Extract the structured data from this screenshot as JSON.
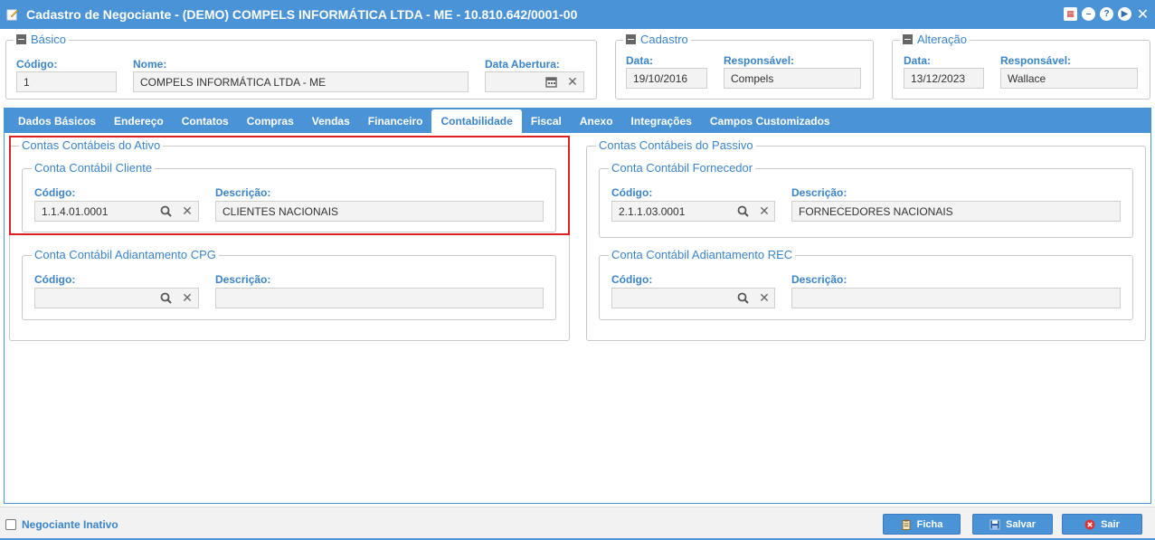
{
  "window": {
    "title": "Cadastro de Negociante - (DEMO) COMPELS INFORMÁTICA LTDA - ME - 10.810.642/0001-00"
  },
  "basico": {
    "legend": "Básico",
    "codigo_label": "Código:",
    "codigo_value": "1",
    "nome_label": "Nome:",
    "nome_value": "COMPELS INFORMÁTICA LTDA - ME",
    "data_abertura_label": "Data Abertura:",
    "data_abertura_value": ""
  },
  "cadastro": {
    "legend": "Cadastro",
    "data_label": "Data:",
    "data_value": "19/10/2016",
    "responsavel_label": "Responsável:",
    "responsavel_value": "Compels"
  },
  "alteracao": {
    "legend": "Alteração",
    "data_label": "Data:",
    "data_value": "13/12/2023",
    "responsavel_label": "Responsável:",
    "responsavel_value": "Wallace"
  },
  "tabs": [
    {
      "label": "Dados Básicos"
    },
    {
      "label": "Endereço"
    },
    {
      "label": "Contatos"
    },
    {
      "label": "Compras"
    },
    {
      "label": "Vendas"
    },
    {
      "label": "Financeiro"
    },
    {
      "label": "Contabilidade",
      "active": true
    },
    {
      "label": "Fiscal"
    },
    {
      "label": "Anexo"
    },
    {
      "label": "Integrações"
    },
    {
      "label": "Campos Customizados"
    }
  ],
  "ativo": {
    "legend": "Contas Contábeis do Ativo",
    "cliente": {
      "legend": "Conta Contábil Cliente",
      "codigo_label": "Código:",
      "codigo_value": "1.1.4.01.0001",
      "descricao_label": "Descrição:",
      "descricao_value": "CLIENTES NACIONAIS"
    },
    "adiantamento": {
      "legend": "Conta Contábil Adiantamento CPG",
      "codigo_label": "Código:",
      "codigo_value": "",
      "descricao_label": "Descrição:",
      "descricao_value": ""
    }
  },
  "passivo": {
    "legend": "Contas Contábeis do Passivo",
    "fornecedor": {
      "legend": "Conta Contábil Fornecedor",
      "codigo_label": "Código:",
      "codigo_value": "2.1.1.03.0001",
      "descricao_label": "Descrição:",
      "descricao_value": "FORNECEDORES NACIONAIS"
    },
    "adiantamento": {
      "legend": "Conta Contábil Adiantamento REC",
      "codigo_label": "Código:",
      "codigo_value": "",
      "descricao_label": "Descrição:",
      "descricao_value": ""
    }
  },
  "footer": {
    "inativo_label": "Negociante Inativo",
    "ficha_label": "Ficha",
    "salvar_label": "Salvar",
    "sair_label": "Sair"
  },
  "icons": {
    "title": "edit-icon",
    "calendar": "calendar-icon",
    "search": "search-icon",
    "clear": "clear-icon"
  },
  "colors": {
    "primary": "#4a93d6",
    "label": "#3a84c9",
    "highlight": "#e02020"
  }
}
